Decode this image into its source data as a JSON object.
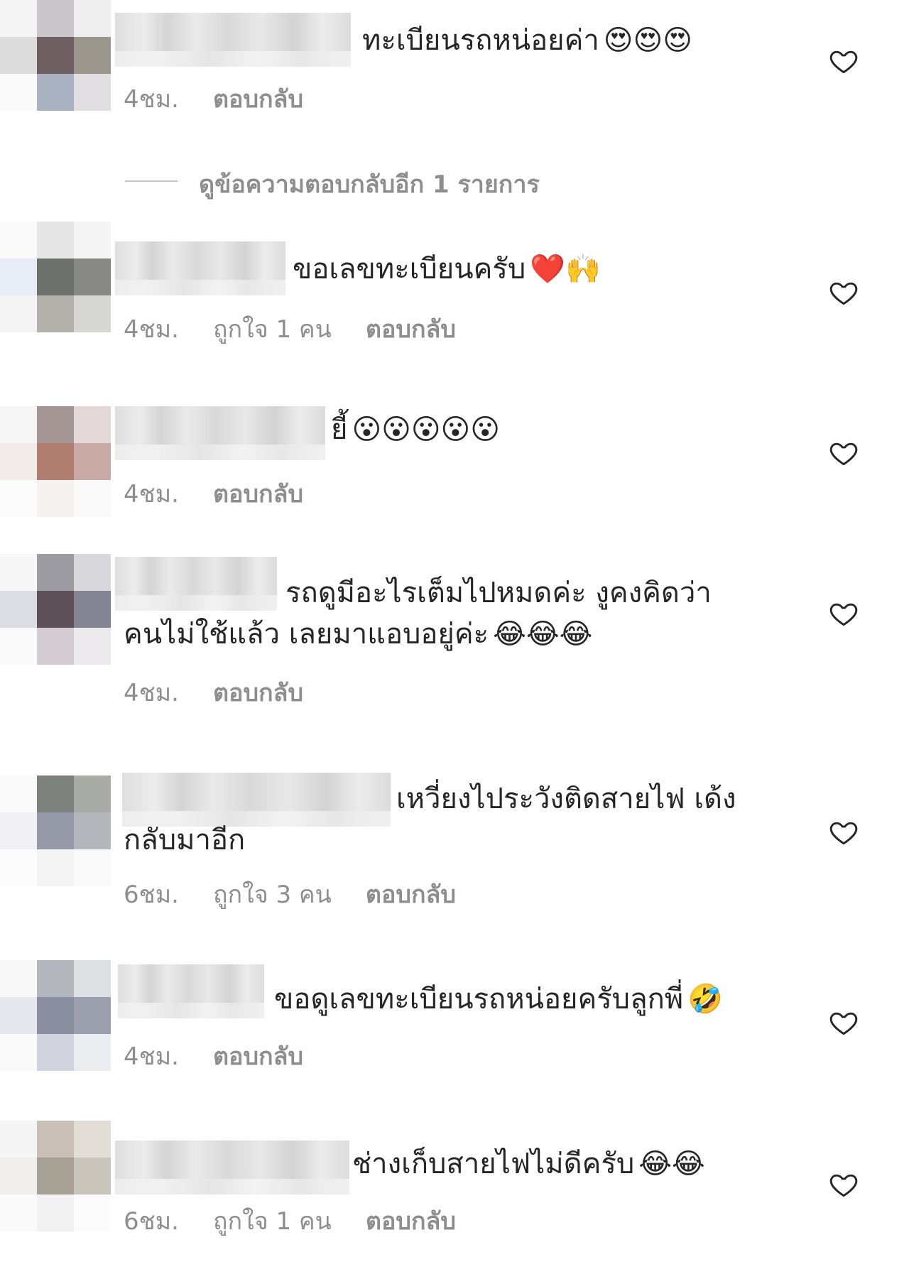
{
  "view_more_replies": "ดูข้อความตอบกลับอีก 1 รายการ",
  "comments": [
    {
      "text": "ทะเบียนรถหน่อยค่า",
      "emoji": "😍😍😍",
      "time": "4ชม.",
      "likes": "",
      "reply": "ตอบกลับ"
    },
    {
      "text": "ขอเลขทะเบียนครับ",
      "emoji": "❤️🙌",
      "time": "4ชม.",
      "likes": "ถูกใจ 1 คน",
      "reply": "ตอบกลับ"
    },
    {
      "text": "ยี้",
      "emoji": "😮😮😮😮😮",
      "time": "4ชม.",
      "likes": "",
      "reply": "ตอบกลับ"
    },
    {
      "text": "รถดูมีอะไรเต็มไปหมดค่ะ งูคงคิดว่า",
      "text2": "คนไม่ใช้แล้ว เลยมาแอบอยู่ค่ะ",
      "emoji": "😂😂😂",
      "time": "4ชม.",
      "likes": "",
      "reply": "ตอบกลับ"
    },
    {
      "text": "เหวี่ยงไประวังติดสายไฟ เด้ง",
      "text2": "กลับมาอีก",
      "emoji": "",
      "time": "6ชม.",
      "likes": "ถูกใจ 3 คน",
      "reply": "ตอบกลับ"
    },
    {
      "text": "ขอดูเลขทะเบียนรถหน่อยครับลูกพี่",
      "emoji": "🤣",
      "time": "4ชม.",
      "likes": "",
      "reply": "ตอบกลับ"
    },
    {
      "text": "ช่างเก็บสายไฟไม่ดีครับ",
      "emoji": "😂😂",
      "time": "6ชม.",
      "likes": "ถูกใจ 1 คน",
      "reply": "ตอบกลับ"
    }
  ],
  "colors": {
    "text": "#262626",
    "meta": "#8e8e8e",
    "divider": "#c7c7c7"
  },
  "icons": {
    "like": "heart-outline-icon"
  }
}
